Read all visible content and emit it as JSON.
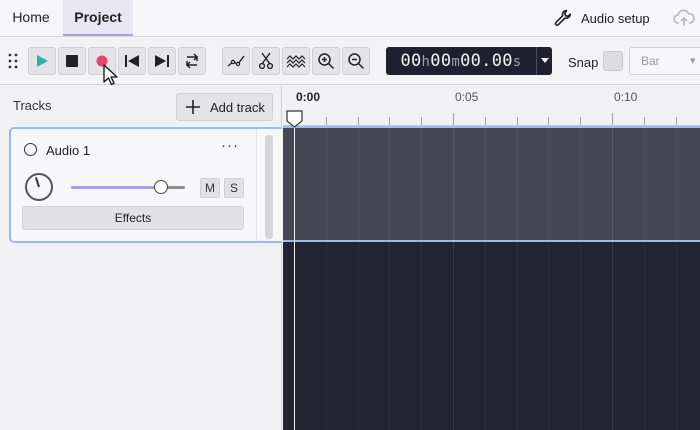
{
  "menu": {
    "tabs": [
      {
        "label": "Home"
      },
      {
        "label": "Project",
        "active": true
      }
    ],
    "audio_setup_label": "Audio setup",
    "audio_setup_icon": "wrench-icon",
    "cloud_icon": "cloud-upload-icon"
  },
  "toolbar": {
    "buttons": [
      "play",
      "stop",
      "record",
      "skip-to-start",
      "skip-to-end",
      "loop",
      "automation",
      "cut",
      "envelope",
      "zoom-in",
      "zoom-out"
    ],
    "time": {
      "h": "00",
      "m": "00",
      "s": "00.00",
      "h_unit": "h",
      "m_unit": "m",
      "s_unit": "s"
    },
    "snap_label": "Snap",
    "snap_checked": false,
    "snap_value": "Bar"
  },
  "tracks": {
    "label": "Tracks",
    "add_track_label": "Add track",
    "items": [
      {
        "name": "Audio 1",
        "more_label": "···",
        "volume": 0.79,
        "mute_label": "M",
        "solo_label": "S",
        "effects_label": "Effects"
      }
    ]
  },
  "timeline": {
    "ruler_labels": [
      "0:00",
      "0:05",
      "0:10"
    ]
  },
  "colors": {
    "accent": "#a6a0e3",
    "selection": "#9db7f0",
    "play": "#2fb3a1",
    "record": "#e8466f",
    "timeline_bg": "#222431",
    "clip_bg": "#454754"
  }
}
